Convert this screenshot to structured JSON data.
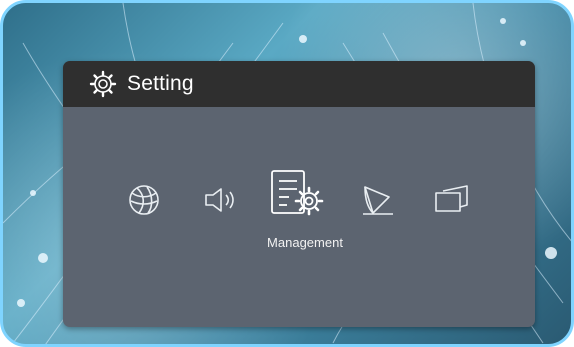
{
  "window": {
    "title": "Setting"
  },
  "menu": {
    "selected_label": "Management",
    "items": [
      {
        "icon": "globe-icon"
      },
      {
        "icon": "speaker-icon"
      },
      {
        "icon": "management-icon"
      },
      {
        "icon": "display-shape-icon"
      },
      {
        "icon": "projection-icon"
      }
    ]
  },
  "colors": {
    "accent_border": "#7fd4ff",
    "titlebar": "#2f2f2f",
    "panel": "#5c6470"
  }
}
